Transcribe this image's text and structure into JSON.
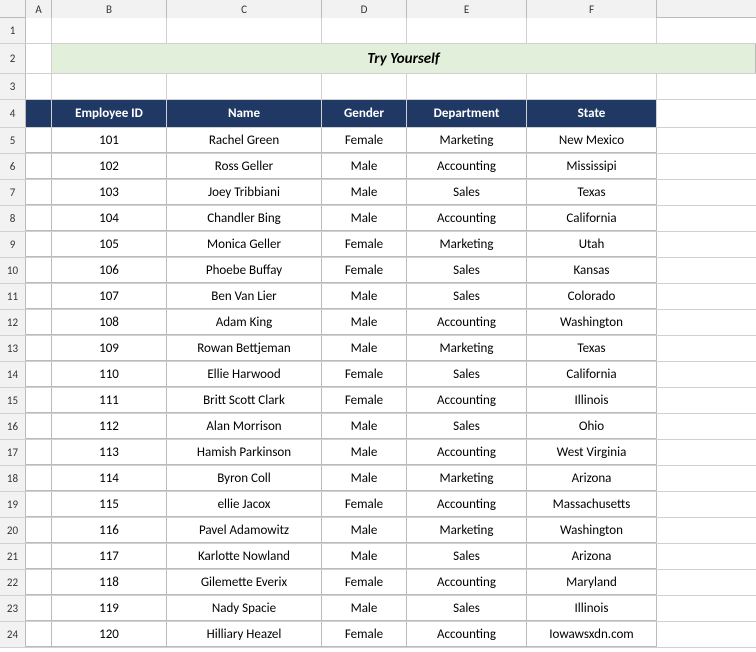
{
  "spreadsheet": {
    "title": "Try Yourself",
    "columns": {
      "a": {
        "label": "A",
        "width": 26
      },
      "b": {
        "label": "B",
        "width": 115
      },
      "c": {
        "label": "C",
        "width": 155
      },
      "d": {
        "label": "D",
        "width": 85
      },
      "e": {
        "label": "E",
        "width": 120
      },
      "f": {
        "label": "F",
        "width": 130
      }
    },
    "headers": {
      "employee_id": "Employee ID",
      "name": "Name",
      "gender": "Gender",
      "department": "Department",
      "state": "State"
    },
    "rows": [
      {
        "id": "101",
        "name": "Rachel Green",
        "gender": "Female",
        "department": "Marketing",
        "state": "New Mexico"
      },
      {
        "id": "102",
        "name": "Ross Geller",
        "gender": "Male",
        "department": "Accounting",
        "state": "Mississipi"
      },
      {
        "id": "103",
        "name": "Joey Tribbiani",
        "gender": "Male",
        "department": "Sales",
        "state": "Texas"
      },
      {
        "id": "104",
        "name": "Chandler Bing",
        "gender": "Male",
        "department": "Accounting",
        "state": "California"
      },
      {
        "id": "105",
        "name": "Monica Geller",
        "gender": "Female",
        "department": "Marketing",
        "state": "Utah"
      },
      {
        "id": "106",
        "name": "Phoebe Buffay",
        "gender": "Female",
        "department": "Sales",
        "state": "Kansas"
      },
      {
        "id": "107",
        "name": "Ben Van Lier",
        "gender": "Male",
        "department": "Sales",
        "state": "Colorado"
      },
      {
        "id": "108",
        "name": "Adam King",
        "gender": "Male",
        "department": "Accounting",
        "state": "Washington"
      },
      {
        "id": "109",
        "name": "Rowan Bettjeman",
        "gender": "Male",
        "department": "Marketing",
        "state": "Texas"
      },
      {
        "id": "110",
        "name": "Ellie Harwood",
        "gender": "Female",
        "department": "Sales",
        "state": "California"
      },
      {
        "id": "111",
        "name": "Britt Scott Clark",
        "gender": "Female",
        "department": "Accounting",
        "state": "Illinois"
      },
      {
        "id": "112",
        "name": "Alan Morrison",
        "gender": "Male",
        "department": "Sales",
        "state": "Ohio"
      },
      {
        "id": "113",
        "name": "Hamish Parkinson",
        "gender": "Male",
        "department": "Accounting",
        "state": "West Virginia"
      },
      {
        "id": "114",
        "name": "Byron Coll",
        "gender": "Male",
        "department": "Marketing",
        "state": "Arizona"
      },
      {
        "id": "115",
        "name": "ellie Jacox",
        "gender": "Female",
        "department": "Accounting",
        "state": "Massachusetts"
      },
      {
        "id": "116",
        "name": "Pavel Adamowitz",
        "gender": "Male",
        "department": "Marketing",
        "state": "Washington"
      },
      {
        "id": "117",
        "name": "Karlotte Nowland",
        "gender": "Male",
        "department": "Sales",
        "state": "Arizona"
      },
      {
        "id": "118",
        "name": "Gilemette Everix",
        "gender": "Female",
        "department": "Accounting",
        "state": "Maryland"
      },
      {
        "id": "119",
        "name": "Nady Spacie",
        "gender": "Male",
        "department": "Sales",
        "state": "Illinois"
      },
      {
        "id": "120",
        "name": "Hilliary Heazel",
        "gender": "Female",
        "department": "Accounting",
        "state": "Iowawsxdn.com"
      }
    ],
    "row_numbers": [
      "1",
      "2",
      "3",
      "4",
      "5",
      "6",
      "7",
      "8",
      "9",
      "10",
      "11",
      "12",
      "13",
      "14",
      "15",
      "16",
      "17",
      "18",
      "19",
      "20",
      "21",
      "22",
      "23",
      "24"
    ]
  }
}
